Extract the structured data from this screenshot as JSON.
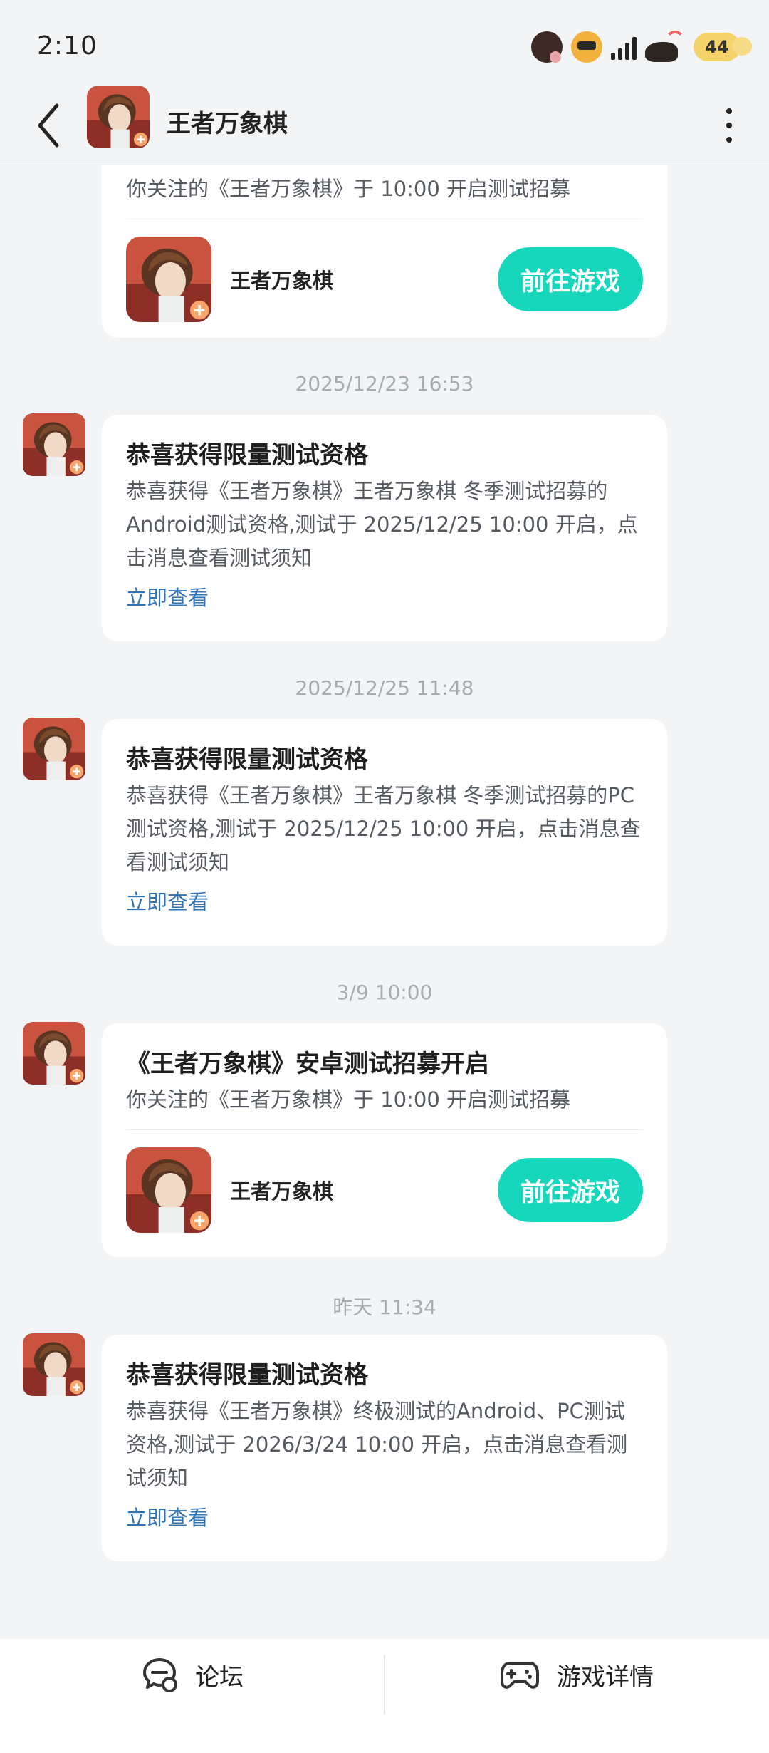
{
  "status_bar": {
    "time": "2:10",
    "battery": "44",
    "icons": [
      "dog-emoji-icon",
      "sunflower-emoji-icon",
      "signal-icon",
      "wifi-icon",
      "battery-icon"
    ]
  },
  "header": {
    "title": "王者万象棋",
    "back_icon": "chevron-left-icon",
    "more_icon": "more-vertical-icon"
  },
  "messages": [
    {
      "timestamp": "",
      "title": "",
      "body": "你关注的《王者万象棋》于 10:00 开启测试招募",
      "game_name": "王者万象棋",
      "button": "前往游戏"
    },
    {
      "timestamp": "2025/12/23   16:53",
      "title": "恭喜获得限量测试资格",
      "body": "恭喜获得《王者万象棋》王者万象棋 冬季测试招募的Android测试资格,测试于 2025/12/25 10:00 开启，点击消息查看测试须知",
      "link": "立即查看"
    },
    {
      "timestamp": "2025/12/25   11:48",
      "title": "恭喜获得限量测试资格",
      "body": "恭喜获得《王者万象棋》王者万象棋 冬季测试招募的PC测试资格,测试于 2025/12/25 10:00 开启，点击消息查看测试须知",
      "link": "立即查看"
    },
    {
      "timestamp": "3/9   10:00",
      "title": "《王者万象棋》安卓测试招募开启",
      "body": "你关注的《王者万象棋》于 10:00 开启测试招募",
      "game_name": "王者万象棋",
      "button": "前往游戏"
    },
    {
      "timestamp": "昨天   11:34",
      "title": "恭喜获得限量测试资格",
      "body": "恭喜获得《王者万象棋》终极测试的Android、PC测试资格,测试于 2026/3/24 10:00 开启，点击消息查看测试须知",
      "link": "立即查看"
    }
  ],
  "bottom_bar": {
    "forum_label": "论坛",
    "forum_icon": "forum-chat-icon",
    "details_label": "游戏详情",
    "details_icon": "gamepad-icon"
  },
  "colors": {
    "accent": "#16d6bb",
    "link": "#2f73b5",
    "background": "#f3f4f6"
  }
}
